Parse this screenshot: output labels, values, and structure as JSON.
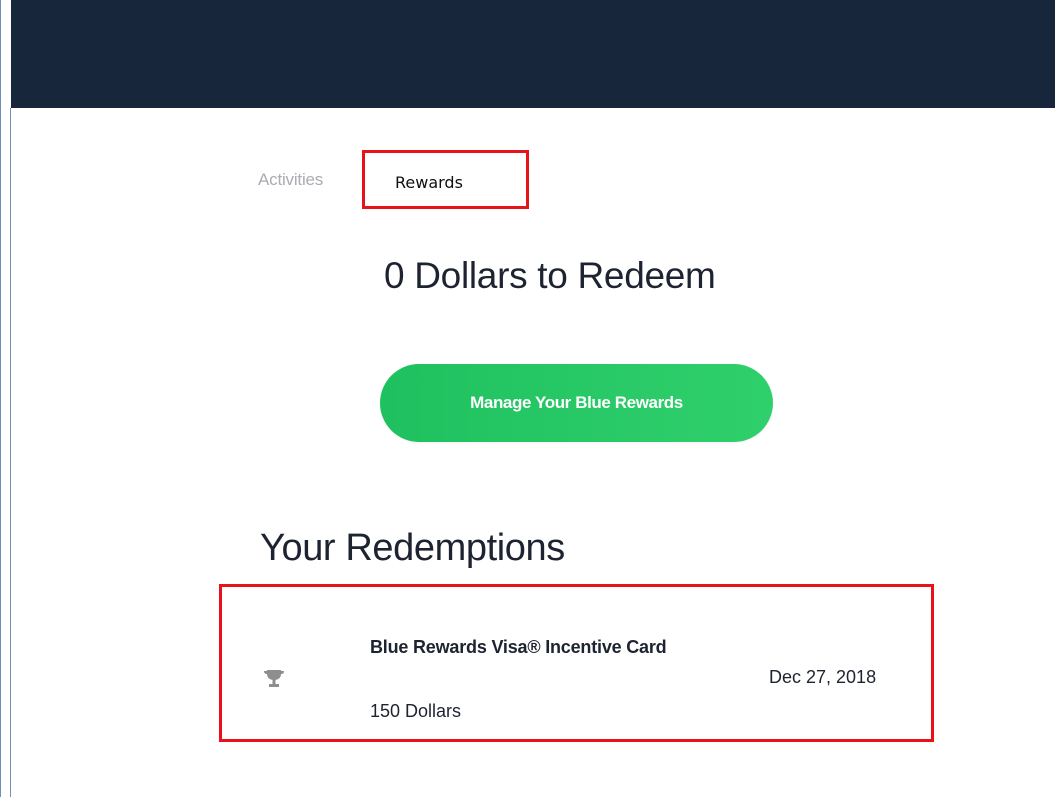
{
  "header": {
    "color": "#17263a"
  },
  "tabs": {
    "activities_label": "Activities",
    "rewards_label": "Rewards",
    "selected": "Rewards"
  },
  "balance": {
    "heading": "0 Dollars to Redeem"
  },
  "manage_button": {
    "label": "Manage Your Blue Rewards",
    "color": "#27c765"
  },
  "redemptions": {
    "heading": "Your Redemptions",
    "items": [
      {
        "icon": "trophy-icon",
        "title": "Blue Rewards Visa® Incentive Card",
        "amount": "150 Dollars",
        "date": "Dec 27, 2018"
      }
    ]
  },
  "highlight_color": "#e8121a"
}
